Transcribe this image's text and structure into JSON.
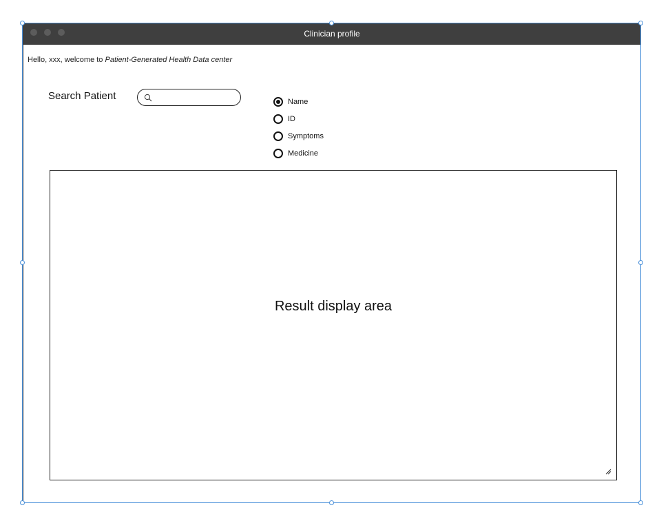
{
  "window": {
    "title": "Clinician profile"
  },
  "welcome": {
    "prefix": "Hello, xxx, welcome to ",
    "app_name": "Patient-Generated Health Data center"
  },
  "search": {
    "label": "Search Patient",
    "value": "",
    "placeholder": ""
  },
  "search_options": {
    "selected": "Name",
    "items": [
      {
        "label": "Name",
        "checked": true
      },
      {
        "label": "ID",
        "checked": false
      },
      {
        "label": "Symptoms",
        "checked": false
      },
      {
        "label": "Medicine",
        "checked": false
      }
    ]
  },
  "result": {
    "placeholder_text": "Result display area"
  },
  "icons": {
    "search": "search-icon",
    "resize": "resize-grip-icon"
  },
  "colors": {
    "titlebar": "#3f3f3f",
    "selection": "#4a90d9"
  }
}
